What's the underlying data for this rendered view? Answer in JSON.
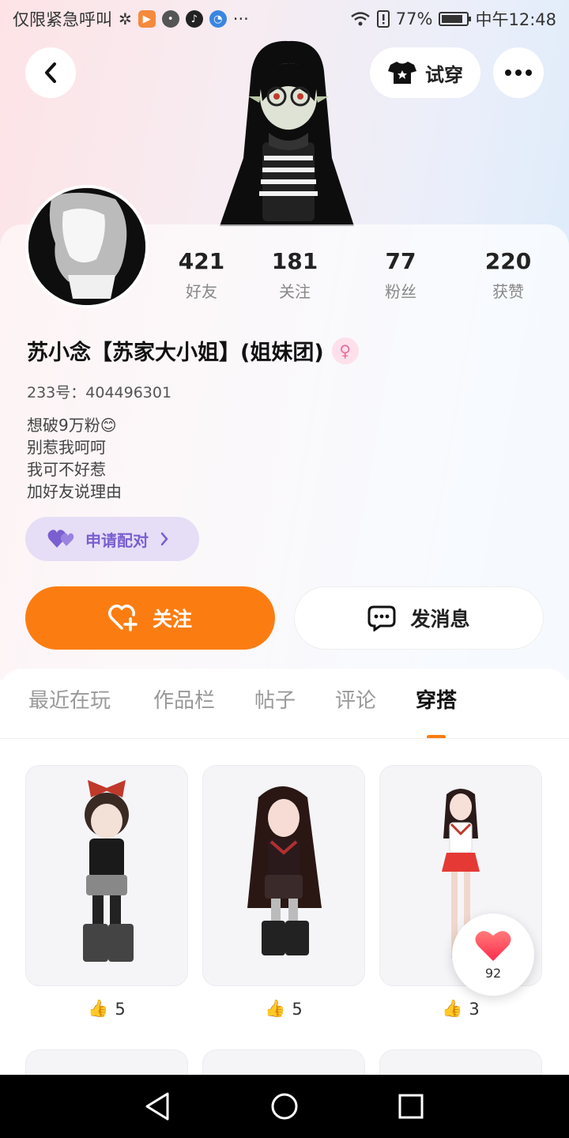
{
  "status_bar": {
    "carrier_text": "仅限紧急呼叫",
    "battery": "77%",
    "time": "中午12:48",
    "more": "···"
  },
  "header": {
    "back_icon": "chevron-left-icon",
    "try_on_label": "试穿",
    "more_icon": "more-dots-icon"
  },
  "profile": {
    "stats": [
      {
        "value": "421",
        "label": "好友"
      },
      {
        "value": "181",
        "label": "关注"
      },
      {
        "value": "77",
        "label": "粉丝"
      },
      {
        "value": "220",
        "label": "获赞"
      }
    ],
    "nickname": "苏小念【苏家大小姐】(姐妹团)",
    "uid": "233号：404496301",
    "bio_lines": [
      "想破9万粉😊",
      "别惹我呵呵",
      "我可不好惹",
      "加好友说理由"
    ],
    "pair_button": "申请配对",
    "follow_button": "关注",
    "message_button": "发消息"
  },
  "tabs": [
    "最近在玩",
    "作品栏",
    "帖子",
    "评论",
    "穿搭"
  ],
  "active_tab_index": 4,
  "outfits": [
    {
      "likes": "5"
    },
    {
      "likes": "5"
    },
    {
      "likes": "3"
    }
  ],
  "floating_like": {
    "count": "92"
  },
  "colors": {
    "accent": "#fb7d12",
    "pair_bg": "#e6def6",
    "pair_text": "#7a5fd0",
    "like_heart": "#ff4d5e"
  }
}
